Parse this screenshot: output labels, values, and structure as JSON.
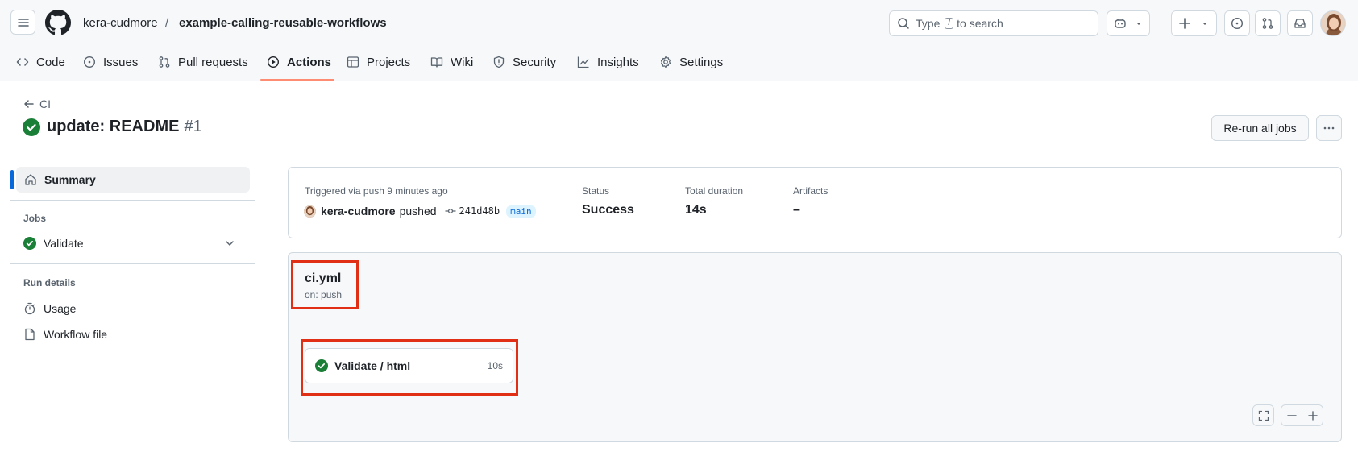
{
  "header": {
    "owner": "kera-cudmore",
    "separator": "/",
    "repo": "example-calling-reusable-workflows",
    "search": {
      "prefix": "Type",
      "key": "/",
      "suffix": "to search"
    }
  },
  "tabs": [
    {
      "label": "Code",
      "icon": "code-icon"
    },
    {
      "label": "Issues",
      "icon": "issue-icon"
    },
    {
      "label": "Pull requests",
      "icon": "pull-request-icon"
    },
    {
      "label": "Actions",
      "icon": "play-icon",
      "selected": true
    },
    {
      "label": "Projects",
      "icon": "table-icon"
    },
    {
      "label": "Wiki",
      "icon": "book-icon"
    },
    {
      "label": "Security",
      "icon": "shield-icon"
    },
    {
      "label": "Insights",
      "icon": "graph-icon"
    },
    {
      "label": "Settings",
      "icon": "gear-icon"
    }
  ],
  "run": {
    "back_label": "CI",
    "title": "update: README",
    "number": "#1",
    "rerun_label": "Re-run all jobs"
  },
  "sidebar": {
    "summary": "Summary",
    "jobs_heading": "Jobs",
    "jobs": [
      {
        "label": "Validate",
        "status": "success"
      }
    ],
    "run_details_heading": "Run details",
    "details": [
      {
        "label": "Usage",
        "icon": "stopwatch-icon"
      },
      {
        "label": "Workflow file",
        "icon": "file-icon"
      }
    ]
  },
  "summary": {
    "trigger_label": "Triggered via push 9 minutes ago",
    "actor": "kera-cudmore",
    "action": "pushed",
    "commit": "241d48b",
    "branch": "main",
    "status_label": "Status",
    "status_value": "Success",
    "duration_label": "Total duration",
    "duration_value": "14s",
    "artifacts_label": "Artifacts",
    "artifacts_value": "–"
  },
  "workflow": {
    "file": "ci.yml",
    "trigger": "on: push",
    "job": {
      "label": "Validate / html",
      "duration": "10s",
      "status": "success"
    }
  },
  "colors": {
    "accent": "#0969da",
    "success": "#1a7f37",
    "tab_underline": "#fd8c73",
    "highlight": "#e02f14"
  }
}
